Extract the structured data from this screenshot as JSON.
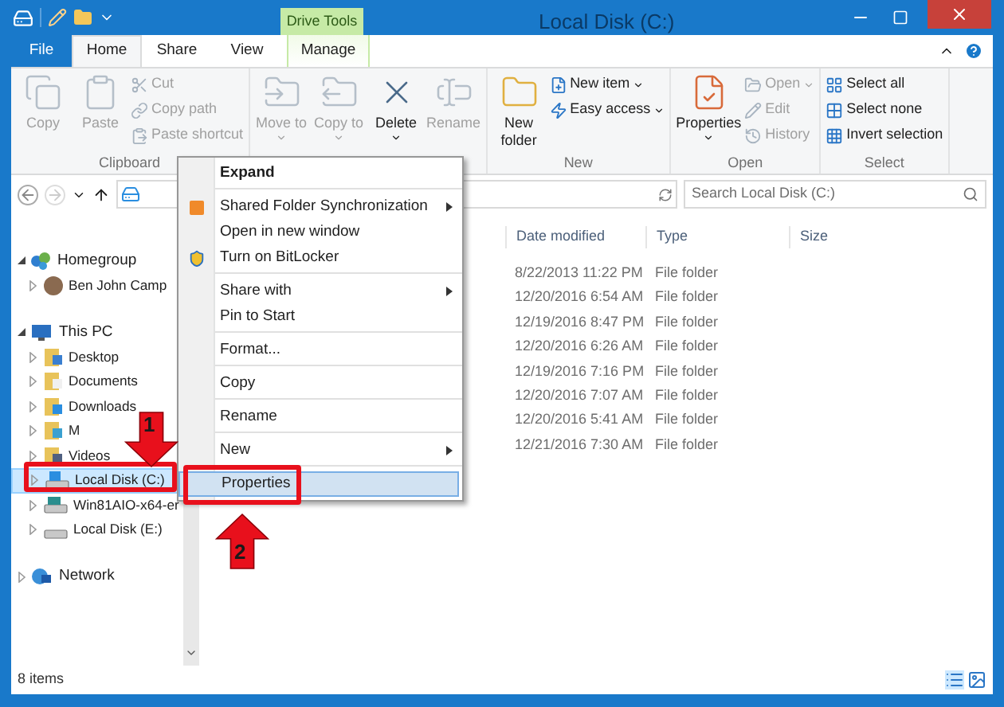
{
  "window": {
    "title": "Local Disk (C:)",
    "context_tab_group": "Drive Tools"
  },
  "tabs": [
    {
      "label": "File",
      "kind": "file",
      "selected": false
    },
    {
      "label": "Home",
      "kind": "tab",
      "selected": true
    },
    {
      "label": "Share",
      "kind": "tab",
      "selected": false
    },
    {
      "label": "View",
      "kind": "tab",
      "selected": false
    },
    {
      "label": "Manage",
      "kind": "context",
      "selected": false
    }
  ],
  "ribbon": [
    {
      "label": "Clipboard",
      "items": [
        {
          "label": "Copy",
          "kind": "large",
          "disabled": true,
          "dropdown": false
        },
        {
          "label": "Paste",
          "kind": "large",
          "disabled": true,
          "dropdown": false
        },
        {
          "label": "Cut",
          "kind": "small",
          "disabled": true,
          "dropdown": false
        },
        {
          "label": "Copy path",
          "kind": "small",
          "disabled": true,
          "dropdown": false
        },
        {
          "label": "Paste shortcut",
          "kind": "small",
          "disabled": true,
          "dropdown": false
        }
      ]
    },
    {
      "items": [
        {
          "label": "Move to",
          "kind": "large",
          "disabled": true,
          "dropdown": true
        },
        {
          "label": "Copy to",
          "kind": "large",
          "disabled": true,
          "dropdown": true
        },
        {
          "label": "Delete",
          "kind": "large",
          "disabled": false,
          "dropdown": true
        },
        {
          "label": "Rename",
          "kind": "large",
          "disabled": true,
          "dropdown": false
        }
      ]
    },
    {
      "label": "New",
      "items": [
        {
          "label": "New folder",
          "kind": "large",
          "disabled": false,
          "dropdown": false
        },
        {
          "label": "New item",
          "kind": "small",
          "disabled": false,
          "dropdown": true
        },
        {
          "label": "Easy access",
          "kind": "small",
          "disabled": false,
          "dropdown": true
        }
      ]
    },
    {
      "label": "Open",
      "items": [
        {
          "label": "Properties",
          "kind": "large",
          "disabled": false,
          "dropdown": true
        },
        {
          "label": "Open",
          "kind": "small",
          "disabled": true,
          "dropdown": true
        },
        {
          "label": "Edit",
          "kind": "small",
          "disabled": true,
          "dropdown": false
        },
        {
          "label": "History",
          "kind": "small",
          "disabled": true,
          "dropdown": false
        }
      ]
    },
    {
      "label": "Select",
      "items": [
        {
          "label": "Select all",
          "kind": "small",
          "disabled": false,
          "dropdown": false
        },
        {
          "label": "Select none",
          "kind": "small",
          "disabled": false,
          "dropdown": false
        },
        {
          "label": "Invert selection",
          "kind": "small",
          "disabled": false,
          "dropdown": false
        }
      ]
    }
  ],
  "search": {
    "placeholder": "Search Local Disk (C:)"
  },
  "navigation": [
    {
      "label": "Homegroup",
      "expanded": true,
      "selected": false,
      "children": [
        {
          "label": "Ben John Camp",
          "expanded": false,
          "selected": false
        }
      ]
    },
    {
      "label": "This PC",
      "expanded": true,
      "selected": false,
      "children": [
        {
          "label": "Desktop",
          "expanded": false,
          "selected": false
        },
        {
          "label": "Documents",
          "expanded": false,
          "selected": false
        },
        {
          "label": "Downloads",
          "expanded": false,
          "selected": false
        },
        {
          "label": "M",
          "expanded": false,
          "selected": false
        },
        {
          "label": "Videos",
          "expanded": false,
          "selected": false
        },
        {
          "label": "Local Disk (C:)",
          "expanded": false,
          "selected": true
        },
        {
          "label": "Win81AIO-x64-er",
          "expanded": false,
          "selected": false
        },
        {
          "label": "Local Disk (E:)",
          "expanded": false,
          "selected": false
        }
      ]
    },
    {
      "label": "Network",
      "expanded": false,
      "selected": false
    }
  ],
  "file_list": {
    "columns": [
      "Date modified",
      "Type",
      "Size"
    ],
    "rows": [
      {
        "date_modified": "8/22/2013 11:22 PM",
        "type": "File folder"
      },
      {
        "date_modified": "12/20/2016 6:54 AM",
        "type": "File folder"
      },
      {
        "date_modified": "12/19/2016 8:47 PM",
        "type": "File folder"
      },
      {
        "date_modified": "12/20/2016 6:26 AM",
        "type": "File folder"
      },
      {
        "date_modified": "12/19/2016 7:16 PM",
        "type": "File folder"
      },
      {
        "date_modified": "12/20/2016 7:07 AM",
        "type": "File folder"
      },
      {
        "date_modified": "12/20/2016 5:41 AM",
        "type": "File folder"
      },
      {
        "date_modified": "12/21/2016 7:30 AM",
        "type": "File folder"
      }
    ]
  },
  "context_menu": [
    [
      {
        "label": "Expand",
        "bold": true,
        "submenu": false,
        "selected": false
      }
    ],
    [
      {
        "label": "Shared Folder Synchronization",
        "bold": false,
        "submenu": true,
        "selected": false
      },
      {
        "label": "Open in new window",
        "bold": false,
        "submenu": false,
        "selected": false
      },
      {
        "label": "Turn on BitLocker",
        "bold": false,
        "submenu": false,
        "selected": false
      }
    ],
    [
      {
        "label": "Share with",
        "bold": false,
        "submenu": true,
        "selected": false
      },
      {
        "label": "Pin to Start",
        "bold": false,
        "submenu": false,
        "selected": false
      }
    ],
    [
      {
        "label": "Format...",
        "bold": false,
        "submenu": false,
        "selected": false
      }
    ],
    [
      {
        "label": "Copy",
        "bold": false,
        "submenu": false,
        "selected": false
      }
    ],
    [
      {
        "label": "Rename",
        "bold": false,
        "submenu": false,
        "selected": false
      }
    ],
    [
      {
        "label": "New",
        "bold": false,
        "submenu": true,
        "selected": false
      }
    ],
    [
      {
        "label": "Properties",
        "bold": false,
        "submenu": false,
        "selected": true
      }
    ]
  ],
  "annotations": [
    {
      "number": "1",
      "kind": "down"
    },
    {
      "number": "2",
      "kind": "up"
    }
  ],
  "status_bar": {
    "item_count": "8 items"
  }
}
